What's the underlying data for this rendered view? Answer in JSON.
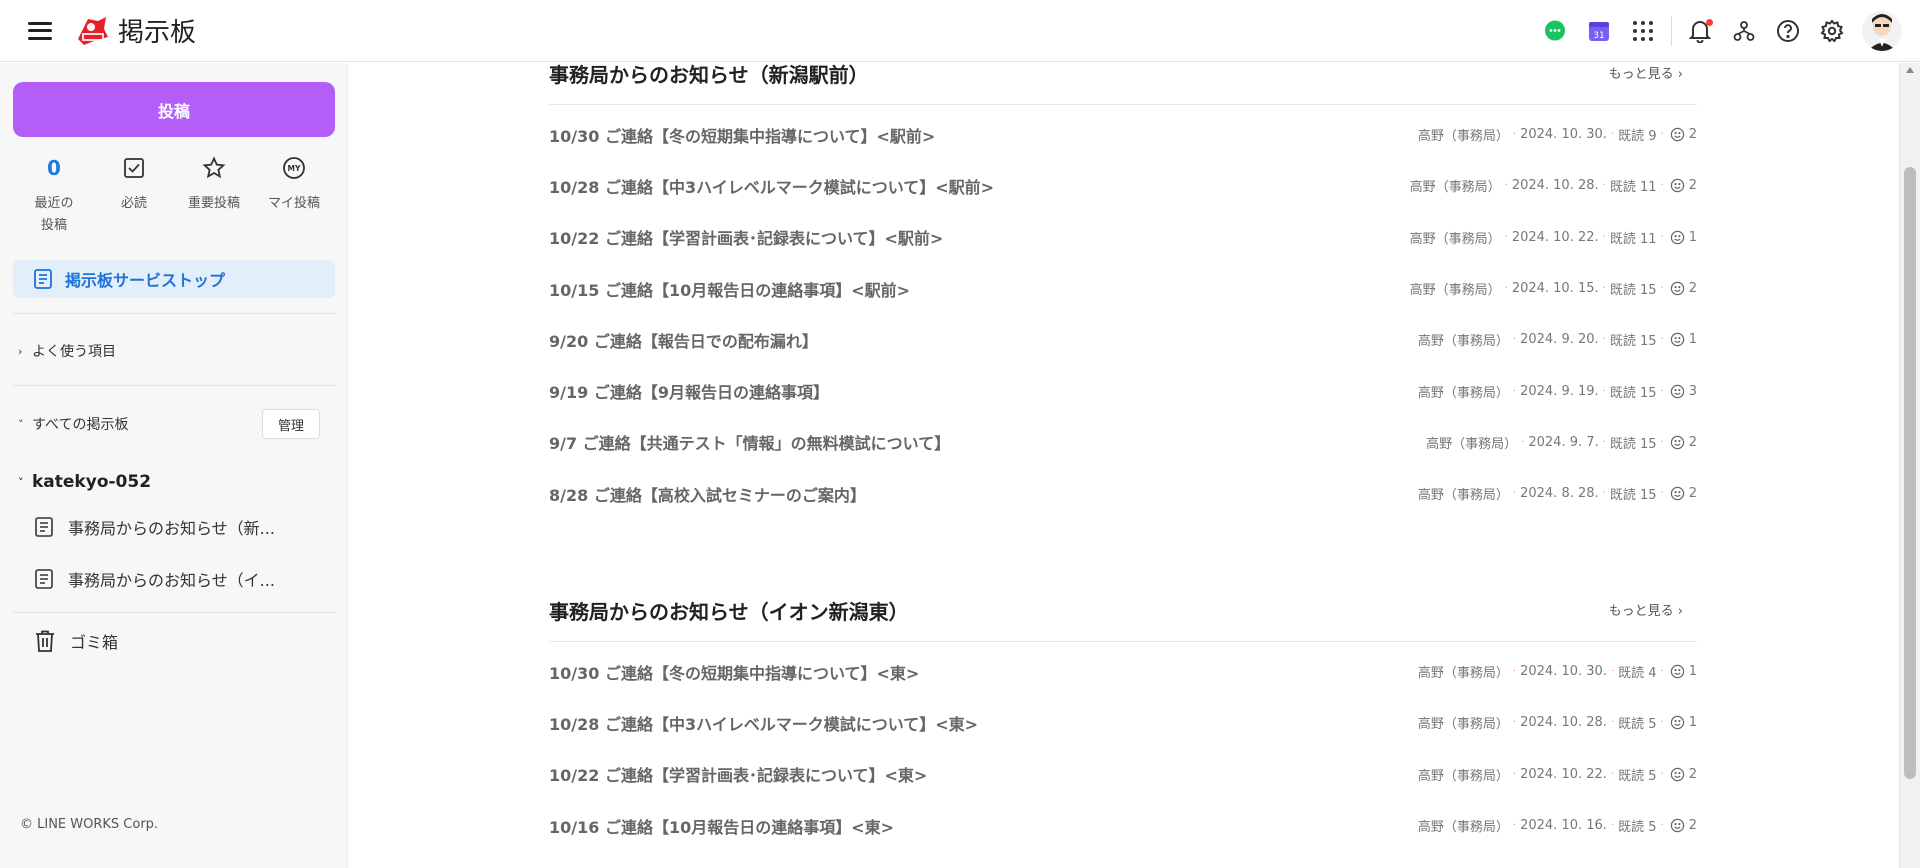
{
  "header": {
    "title": "掲示板",
    "icons": [
      "menu-icon",
      "chat-icon",
      "calendar-icon",
      "apps-grid-icon",
      "bell-icon",
      "org-chart-icon",
      "help-icon",
      "gear-icon"
    ],
    "calendar_day": "31",
    "colors": {
      "chat": "#19c35f",
      "calendar": "#7b5cf5",
      "notification": "#ff3b30"
    }
  },
  "sidebar": {
    "post_button": "投稿",
    "post_button_color": "#b45ef7",
    "quick": {
      "recent_count": "0",
      "recent_label": "最近の投稿",
      "required_label": "必読",
      "important_label": "重要投稿",
      "my_posts_label": "マイ投稿",
      "my_badge": "MY"
    },
    "active_item": "掲示板サービストップ",
    "frequent_label": "よく使う項目",
    "all_boards_label": "すべての掲示板",
    "manage_label": "管理",
    "group_name": "katekyo-052",
    "boards": [
      "事務局からのお知らせ（新...",
      "事務局からのお知らせ（イ..."
    ],
    "trash_label": "ゴミ箱",
    "copyright": "© LINE WORKS Corp."
  },
  "main": {
    "sections": [
      {
        "title": "事務局からのお知らせ（新潟駅前）",
        "more": "もっと見る ›",
        "rows": [
          {
            "title": "10/30 ご連絡【冬の短期集中指導について】<駅前>",
            "author": "高野（事務局）",
            "date": "2024. 10. 30.",
            "read": "既読 9",
            "reactions": "2"
          },
          {
            "title": "10/28 ご連絡【中3ハイレベルマーク模試について】<駅前>",
            "author": "高野（事務局）",
            "date": "2024. 10. 28.",
            "read": "既読 11",
            "reactions": "2"
          },
          {
            "title": "10/22 ご連絡【学習計画表･記録表について】<駅前>",
            "author": "高野（事務局）",
            "date": "2024. 10. 22.",
            "read": "既読 11",
            "reactions": "1"
          },
          {
            "title": "10/15 ご連絡【10月報告日の連絡事項】<駅前>",
            "author": "高野（事務局）",
            "date": "2024. 10. 15.",
            "read": "既読 15",
            "reactions": "2"
          },
          {
            "title": "9/20 ご連絡【報告日での配布漏れ】",
            "author": "高野（事務局）",
            "date": "2024. 9. 20.",
            "read": "既読 15",
            "reactions": "1"
          },
          {
            "title": "9/19 ご連絡【9月報告日の連絡事項】",
            "author": "高野（事務局）",
            "date": "2024. 9. 19.",
            "read": "既読 15",
            "reactions": "3"
          },
          {
            "title": "9/7 ご連絡【共通テスト「情報」の無料模試について】",
            "author": "高野（事務局）",
            "date": "2024. 9. 7.",
            "read": "既読 15",
            "reactions": "2"
          },
          {
            "title": "8/28 ご連絡【高校入試セミナーのご案内】",
            "author": "高野（事務局）",
            "date": "2024. 8. 28.",
            "read": "既読 15",
            "reactions": "2"
          }
        ]
      },
      {
        "title": "事務局からのお知らせ（イオン新潟東）",
        "more": "もっと見る ›",
        "rows": [
          {
            "title": "10/30 ご連絡【冬の短期集中指導について】<東>",
            "author": "高野（事務局）",
            "date": "2024. 10. 30.",
            "read": "既読 4",
            "reactions": "1"
          },
          {
            "title": "10/28 ご連絡【中3ハイレベルマーク模試について】<東>",
            "author": "高野（事務局）",
            "date": "2024. 10. 28.",
            "read": "既読 5",
            "reactions": "1"
          },
          {
            "title": "10/22 ご連絡【学習計画表･記録表について】<東>",
            "author": "高野（事務局）",
            "date": "2024. 10. 22.",
            "read": "既読 5",
            "reactions": "2"
          },
          {
            "title": "10/16 ご連絡【10月報告日の連絡事項】<東>",
            "author": "高野（事務局）",
            "date": "2024. 10. 16.",
            "read": "既読 5",
            "reactions": "2"
          }
        ]
      }
    ]
  }
}
